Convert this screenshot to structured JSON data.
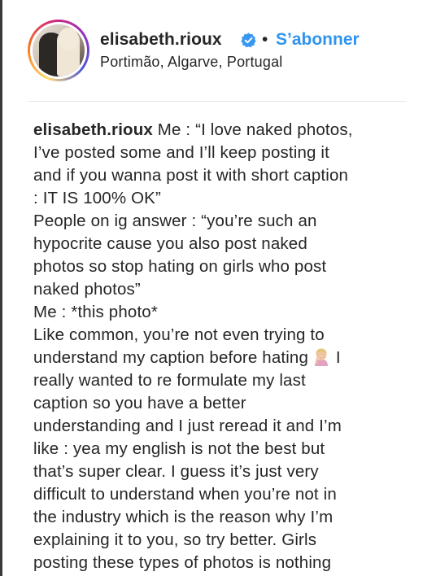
{
  "post": {
    "username": "elisabeth.rioux",
    "separator": "•",
    "follow_label": "S’abonner",
    "location": "Portimão, Algarve, Portugal"
  },
  "caption": {
    "username": "elisabeth.rioux",
    "lines": [
      " Me : “I love naked photos,",
      "I’ve posted some and I’ll keep posting it",
      "and if you wanna post it with short caption",
      ": IT IS 100% OK”",
      "People on ig answer : “you’re such an",
      "hypocrite cause you also post naked",
      "photos so stop hating on girls who post",
      "naked photos”",
      "Me : *this photo*",
      "Like common, you’re not even trying to",
      "understand my caption before hating",
      "really wanted to re formulate my last",
      "caption so you have a better",
      "understanding and I just reread it and I’m",
      "like : yea my english is not the best but",
      "that’s super clear. I guess it’s just very",
      "difficult to understand when you’re not in",
      "the industry which is the reason why I’m",
      "explaining it to you, so try better. Girls",
      "posting these types of photos is nothing"
    ],
    "after_emoji": " I"
  },
  "icons": {
    "verified": "verified-badge-icon",
    "emoji": "person-facepalming-emoji"
  },
  "colors": {
    "follow": "#2f94ee",
    "verified": "#3897f0",
    "text": "#262626"
  }
}
